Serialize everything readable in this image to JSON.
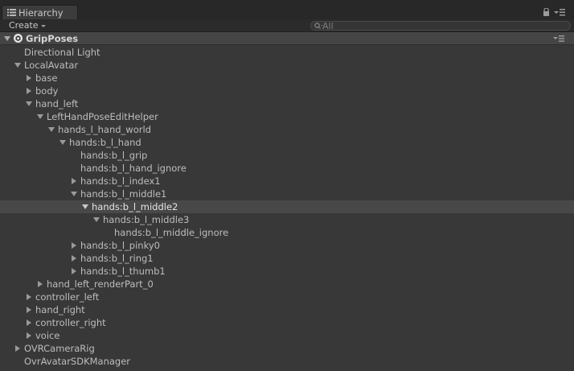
{
  "window": {
    "tab_label": "Hierarchy"
  },
  "toolbar": {
    "create_label": "Create",
    "search_placeholder": "All"
  },
  "scene": {
    "title": "GripPoses"
  },
  "tree": [
    {
      "label": "Directional Light",
      "depth": 1,
      "arrow": "none"
    },
    {
      "label": "LocalAvatar",
      "depth": 1,
      "arrow": "expanded"
    },
    {
      "label": "base",
      "depth": 2,
      "arrow": "collapsed"
    },
    {
      "label": "body",
      "depth": 2,
      "arrow": "collapsed"
    },
    {
      "label": "hand_left",
      "depth": 2,
      "arrow": "expanded"
    },
    {
      "label": "LeftHandPoseEditHelper",
      "depth": 3,
      "arrow": "expanded"
    },
    {
      "label": "hands_l_hand_world",
      "depth": 4,
      "arrow": "expanded"
    },
    {
      "label": "hands:b_l_hand",
      "depth": 5,
      "arrow": "expanded"
    },
    {
      "label": "hands:b_l_grip",
      "depth": 6,
      "arrow": "none"
    },
    {
      "label": "hands:b_l_hand_ignore",
      "depth": 6,
      "arrow": "none"
    },
    {
      "label": "hands:b_l_index1",
      "depth": 6,
      "arrow": "collapsed"
    },
    {
      "label": "hands:b_l_middle1",
      "depth": 6,
      "arrow": "expanded"
    },
    {
      "label": "hands:b_l_middle2",
      "depth": 7,
      "arrow": "expanded",
      "selected": true
    },
    {
      "label": "hands:b_l_middle3",
      "depth": 8,
      "arrow": "expanded"
    },
    {
      "label": "hands:b_l_middle_ignore",
      "depth": 9,
      "arrow": "none"
    },
    {
      "label": "hands:b_l_pinky0",
      "depth": 6,
      "arrow": "collapsed"
    },
    {
      "label": "hands:b_l_ring1",
      "depth": 6,
      "arrow": "collapsed"
    },
    {
      "label": "hands:b_l_thumb1",
      "depth": 6,
      "arrow": "collapsed"
    },
    {
      "label": "hand_left_renderPart_0",
      "depth": 3,
      "arrow": "collapsed"
    },
    {
      "label": "controller_left",
      "depth": 2,
      "arrow": "collapsed"
    },
    {
      "label": "hand_right",
      "depth": 2,
      "arrow": "collapsed"
    },
    {
      "label": "controller_right",
      "depth": 2,
      "arrow": "collapsed"
    },
    {
      "label": "voice",
      "depth": 2,
      "arrow": "collapsed"
    },
    {
      "label": "OVRCameraRig",
      "depth": 1,
      "arrow": "collapsed"
    },
    {
      "label": "OvrAvatarSDKManager",
      "depth": 1,
      "arrow": "none"
    }
  ]
}
